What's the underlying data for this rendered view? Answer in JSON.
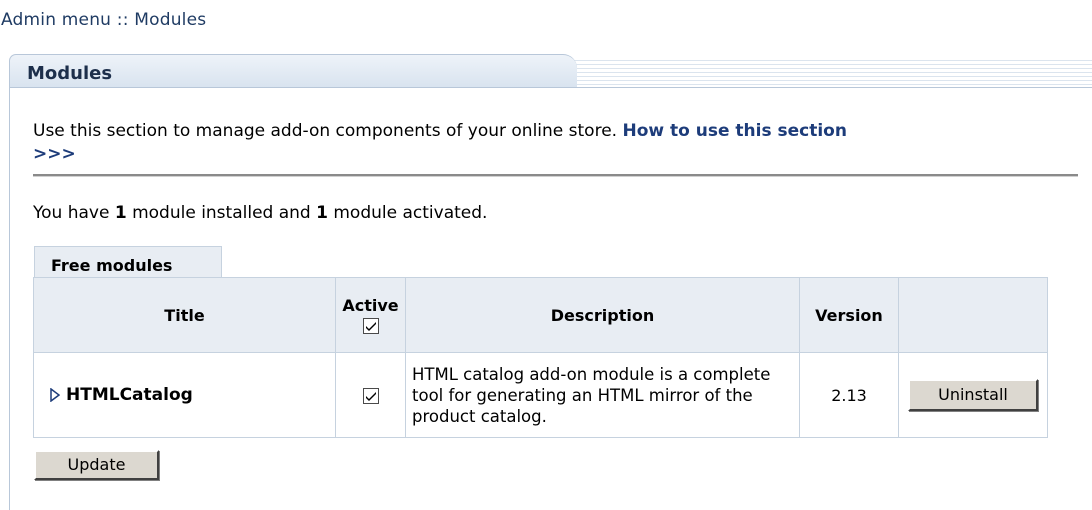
{
  "breadcrumb": {
    "root": "Admin menu",
    "separator": " :: ",
    "current": "Modules"
  },
  "panel": {
    "title": "Modules"
  },
  "intro": {
    "text": "Use this section to manage add-on components of your online store.",
    "help_link": "How to use this section",
    "help_arrows": ">>>"
  },
  "summary": {
    "prefix": "You have ",
    "installed_count": "1",
    "middle": " module installed and ",
    "activated_count": "1",
    "suffix": " module activated."
  },
  "section_tab": "Free modules",
  "table": {
    "headers": {
      "title": "Title",
      "active": "Active",
      "description": "Description",
      "version": "Version",
      "action": ""
    },
    "header_active_checked": true,
    "rows": [
      {
        "title": "HTMLCatalog",
        "active": true,
        "description": "HTML catalog add-on module is a complete tool for generating an HTML mirror of the product catalog.",
        "version": "2.13",
        "action_label": "Uninstall"
      }
    ]
  },
  "buttons": {
    "update_label": "Update"
  },
  "colors": {
    "link": "#1d3c7a",
    "header_bg": "#e8edf3",
    "border": "#c6d2df"
  },
  "icons": {
    "expand": "triangle-right-icon",
    "check": "checkmark-icon"
  }
}
